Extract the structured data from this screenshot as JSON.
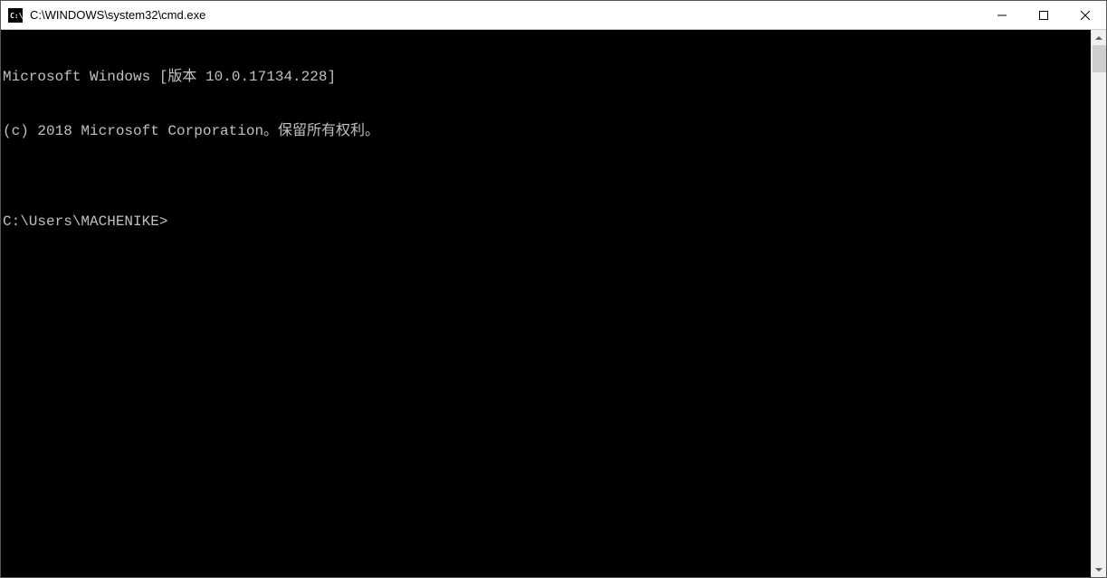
{
  "titlebar": {
    "title": "C:\\WINDOWS\\system32\\cmd.exe"
  },
  "console": {
    "line1": "Microsoft Windows [版本 10.0.17134.228]",
    "line2": "(c) 2018 Microsoft Corporation。保留所有权利。",
    "blank": "",
    "prompt": "C:\\Users\\MACHENIKE>"
  }
}
